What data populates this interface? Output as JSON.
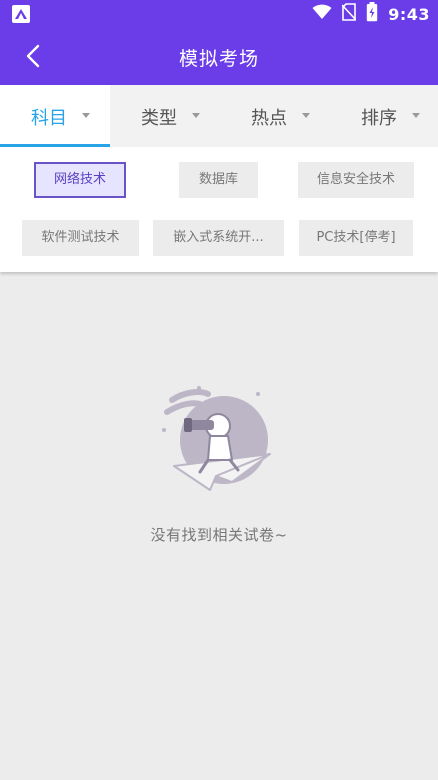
{
  "status_bar": {
    "time": "9:43"
  },
  "header": {
    "title": "模拟考场"
  },
  "tabs": [
    {
      "label": "科目",
      "active": true
    },
    {
      "label": "类型",
      "active": false
    },
    {
      "label": "热点",
      "active": false
    },
    {
      "label": "排序",
      "active": false
    }
  ],
  "options": [
    {
      "label": "网络技术",
      "selected": true
    },
    {
      "label": "数据库",
      "selected": false
    },
    {
      "label": "信息安全技术",
      "selected": false
    },
    {
      "label": "软件测试技术",
      "selected": false
    },
    {
      "label": "嵌入式系统开...",
      "selected": false
    },
    {
      "label": "PC技术[停考]",
      "selected": false
    }
  ],
  "empty_state": {
    "message": "没有找到相关试卷~"
  },
  "colors": {
    "brand_purple": "#6a3de8",
    "tab_active": "#29a3e8",
    "chip_selected_border": "#6a52c8"
  }
}
